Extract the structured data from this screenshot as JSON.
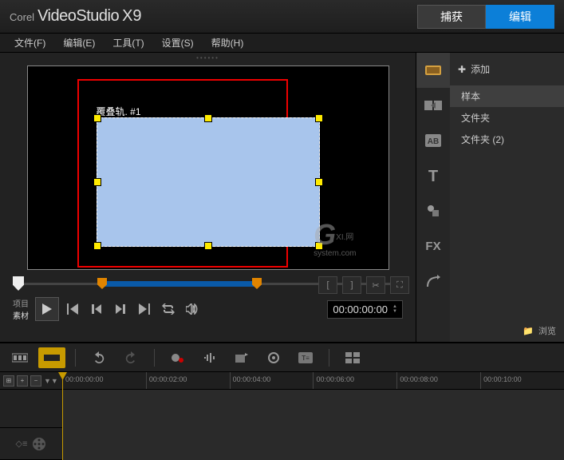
{
  "brand": {
    "corel": "Corel",
    "app": "VideoStudio",
    "ver": "X9"
  },
  "tabs": {
    "capture": "捕获",
    "edit": "编辑"
  },
  "menu": {
    "file": "文件(F)",
    "edit": "编辑(E)",
    "tool": "工具(T)",
    "settings": "设置(S)",
    "help": "帮助(H)"
  },
  "preview": {
    "overlay_label": "覆叠轨. #1"
  },
  "watermark": {
    "g": "G",
    "line1": "XI.网",
    "line2": "system.com"
  },
  "transport": {
    "project": "项目",
    "clip": "素材",
    "timecode": "00:00:00:00"
  },
  "sidebar": {
    "add": "添加",
    "items": [
      "样本",
      "文件夹",
      "文件夹 (2)"
    ],
    "browse": "浏览"
  },
  "timeline": {
    "ticks": [
      "00:00:00:00",
      "00:00:02:00",
      "00:00:04:00",
      "00:00:06:00",
      "00:00:08:00",
      "00:00:10:00"
    ]
  }
}
